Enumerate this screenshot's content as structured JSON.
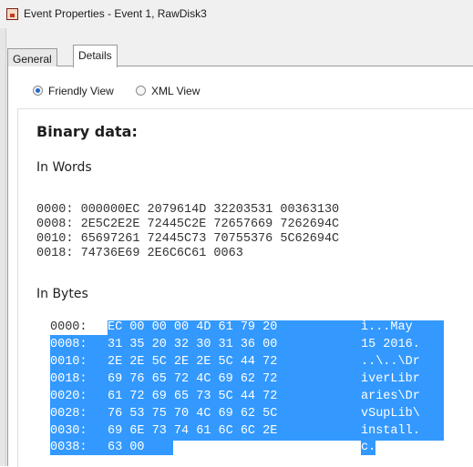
{
  "window": {
    "title": "Event Properties - Event 1, RawDisk3"
  },
  "tabs": [
    {
      "label": "General",
      "active": false
    },
    {
      "label": "Details",
      "active": true
    }
  ],
  "view_options": [
    {
      "label": "Friendly View",
      "selected": true
    },
    {
      "label": "XML View",
      "selected": false
    }
  ],
  "binary": {
    "heading": "Binary data:",
    "words_label": "In Words",
    "words": [
      "0000: 000000EC 2079614D 32203531 00363130",
      "0008: 2E5C2E2E 72445C2E 72657669 7262694C",
      "0010: 65697261 72445C73 70755376 5C62694C",
      "0018: 74736E69 2E6C6C61 0063"
    ],
    "bytes_label": "In Bytes",
    "bytes": [
      {
        "offset": "0000:",
        "hex": "EC 00 00 00 4D 61 79 20",
        "ascii": "ì...May"
      },
      {
        "offset": "0008:",
        "hex": "31 35 20 32 30 31 36 00",
        "ascii": "15 2016."
      },
      {
        "offset": "0010:",
        "hex": "2E 2E 5C 2E 2E 5C 44 72",
        "ascii": "..\\..\\Dr"
      },
      {
        "offset": "0018:",
        "hex": "69 76 65 72 4C 69 62 72",
        "ascii": "iverLibr"
      },
      {
        "offset": "0020:",
        "hex": "61 72 69 65 73 5C 44 72",
        "ascii": "aries\\Dr"
      },
      {
        "offset": "0028:",
        "hex": "76 53 75 70 4C 69 62 5C",
        "ascii": "vSupLib\\"
      },
      {
        "offset": "0030:",
        "hex": "69 6E 73 74 61 6C 6C 2E",
        "ascii": "install."
      },
      {
        "offset": "0038:",
        "hex": "63 00",
        "ascii": "c."
      }
    ]
  },
  "colors": {
    "selection": "#3399ff",
    "radio_accent": "#2169c9"
  }
}
